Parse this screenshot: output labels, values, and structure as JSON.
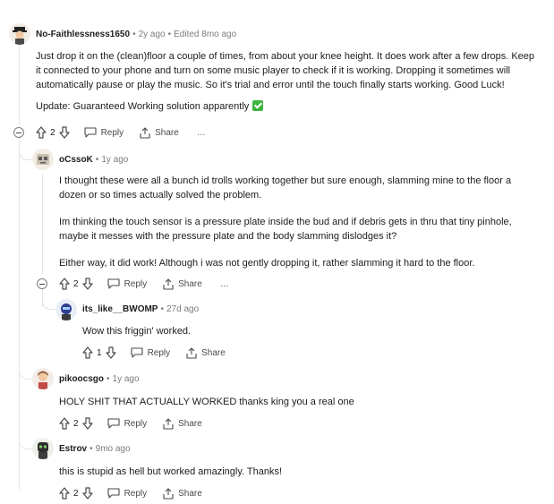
{
  "comments": [
    {
      "user": "No-Faithlessness1650",
      "age": "2y ago",
      "edited": "Edited 8mo ago",
      "text": "Just drop it on the (clean)floor a couple of times, from about your knee height. It does work after a few drops. Keep it connected to your phone and turn on some music player to check if it is working. Dropping it sometimes will automatically pause or play the music. So it's trial and error until the touch finally starts working. Good Luck!",
      "update": "Update: Guaranteed Working solution apparently",
      "votes": "2"
    },
    {
      "user": "oCssoK",
      "age": "1y ago",
      "p1": "I thought these were all a bunch id trolls working together but sure enough, slamming mine to the floor a dozen or so times actually solved the problem.",
      "p2": "Im thinking the touch sensor is a pressure plate inside the bud and if debris gets in thru that tiny pinhole, maybe it messes with the pressure plate and the body slamming dislodges it?",
      "p3": "Either way, it did work! Although i was not gently dropping it, rather slamming it hard to the floor.",
      "votes": "2"
    },
    {
      "user": "its_like__BWOMP",
      "age": "27d ago",
      "text": "Wow this friggin' worked.",
      "votes": "1"
    },
    {
      "user": "pikoocsgo",
      "age": "1y ago",
      "text": "HOLY SHIT THAT ACTUALLY WORKED thanks king you a real one",
      "votes": "2"
    },
    {
      "user": "Estrov",
      "age": "9mo ago",
      "text": "this is stupid as hell but worked amazingly. Thanks!",
      "votes": "2"
    }
  ],
  "actions": {
    "reply": "Reply",
    "share": "Share",
    "more": "…"
  },
  "colors": {
    "text": "#1c1c1c",
    "meta": "#7c7c7c",
    "line": "#e5e5e5",
    "check": "#3db53d"
  }
}
